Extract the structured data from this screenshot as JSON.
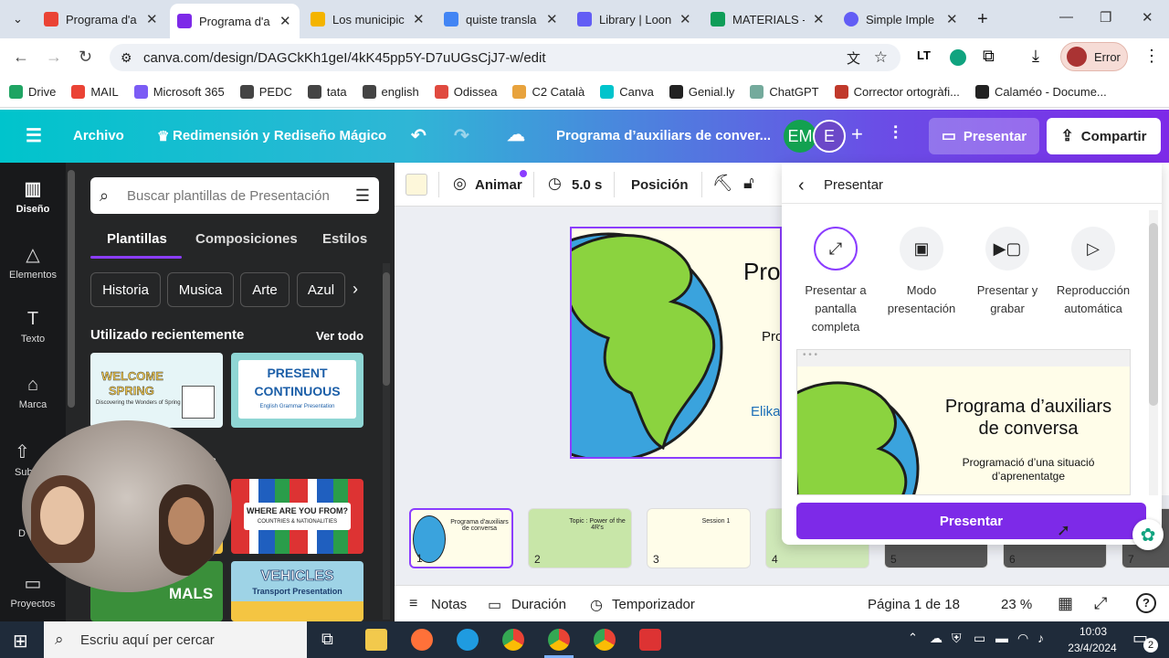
{
  "browser": {
    "tabs": [
      {
        "label": "Programa d'a",
        "color": "#ea4335",
        "active": false
      },
      {
        "label": "Programa d'a",
        "color": "#7d2ae8",
        "active": true
      },
      {
        "label": "Los municipic",
        "color": "#f4b400",
        "active": false
      },
      {
        "label": "quiste transla",
        "color": "#4285f4",
        "active": false
      },
      {
        "label": "Library | Loon",
        "color": "#625df5",
        "active": false
      },
      {
        "label": "MATERIALS -",
        "color": "#0f9d58",
        "active": false
      },
      {
        "label": "Simple Imple",
        "color": "#625df5",
        "active": false
      }
    ],
    "url": "canva.com/design/DAGCkKh1geI/4kK45pp5Y-D7uUGsCjJ7-w/edit",
    "error_label": "Error",
    "bookmarks": [
      {
        "label": "Drive",
        "color": "#1fa463"
      },
      {
        "label": "MAIL",
        "color": "#ea4335"
      },
      {
        "label": "Microsoft 365",
        "color": "#7b5cf5"
      },
      {
        "label": "PEDC",
        "color": "#444444"
      },
      {
        "label": "tata",
        "color": "#444444"
      },
      {
        "label": "english",
        "color": "#444444"
      },
      {
        "label": "Odissea",
        "color": "#e04a3f"
      },
      {
        "label": "C2 Català",
        "color": "#e8a33d"
      },
      {
        "label": "Canva",
        "color": "#00c4cc"
      },
      {
        "label": "Genial.ly",
        "color": "#222222"
      },
      {
        "label": "ChatGPT",
        "color": "#74aa9c"
      },
      {
        "label": "Corrector ortogràfi...",
        "color": "#c0392b"
      },
      {
        "label": "Calaméo - Docume...",
        "color": "#222222"
      }
    ]
  },
  "canva": {
    "menu": {
      "archivo": "Archivo",
      "magic": "Redimensión y Rediseño Mágico",
      "doc_title": "Programa d’auxiliars de conver..."
    },
    "avatars": [
      {
        "initials": "EM",
        "color": "#12a150"
      },
      {
        "initials": "E",
        "color": "#6b48c8"
      }
    ],
    "presentar_label": "Presentar",
    "compartir_label": "Compartir",
    "rail": [
      {
        "label": "Diseño",
        "icon": "layout-icon"
      },
      {
        "label": "Elementos",
        "icon": "shapes-icon"
      },
      {
        "label": "Texto",
        "icon": "text-icon"
      },
      {
        "label": "Marca",
        "icon": "brand-icon"
      },
      {
        "label": "Sub",
        "icon": "upload-icon"
      },
      {
        "label": "D",
        "icon": "draw-icon"
      },
      {
        "label": "Proyectos",
        "icon": "folder-icon"
      }
    ],
    "panel": {
      "search_placeholder": "Buscar plantillas de Presentación",
      "tabs": [
        "Plantillas",
        "Composiciones",
        "Estilos"
      ],
      "chips": [
        "Historia",
        "Musica",
        "Arte",
        "Azul"
      ],
      "recent_title": "Utilizado recientemente",
      "ver_todo": "Ver todo",
      "section2_fragment": "ados",
      "thumbs": {
        "t1_line1": "WELCOME",
        "t1_line2": "SPRING",
        "t1_sub": "Discovering the Wonders of Spring",
        "t2_line1": "PRESENT",
        "t2_line2": "CONTINUOUS",
        "t2_sub": "English Grammar Presentation",
        "t3_title": "WHERE ARE YOU FROM?",
        "t3_sub": "COUNTRIES & NATIONALITIES",
        "t4_title": "VEHICLES",
        "t4_sub": "Transport Presentation",
        "t5_title": "MALS"
      }
    },
    "toolbar": {
      "animar": "Animar",
      "duration": "5.0 s",
      "posicion": "Posición"
    },
    "slide": {
      "title_fragment": "Prog",
      "sub_fragment": "Pro",
      "author_fragment": "Elika"
    },
    "present_panel": {
      "back_title": "Presentar",
      "options": [
        {
          "label": "Presentar a pantalla completa",
          "icon": "expand-icon"
        },
        {
          "label": "Modo presentación",
          "icon": "presenter-icon"
        },
        {
          "label": "Presentar y grabar",
          "icon": "camera-icon"
        },
        {
          "label": "Reproducción automática",
          "icon": "play-icon"
        }
      ],
      "preview_title": "Programa d’auxiliars de conversa",
      "preview_sub": "Programació d’una situació d’aprenentatge",
      "button": "Presentar"
    },
    "filmstrip": [
      {
        "num": "1",
        "title": "Programa d'auxiliars de conversa"
      },
      {
        "num": "2",
        "title": "Topic : Power of the 4R's"
      },
      {
        "num": "3",
        "title": "Session 1"
      },
      {
        "num": "4",
        "title": ""
      },
      {
        "num": "5",
        "title": ""
      },
      {
        "num": "6",
        "title": ""
      },
      {
        "num": "7",
        "title": ""
      }
    ],
    "bottombar": {
      "notas": "Notas",
      "duracion": "Duración",
      "temporizador": "Temporizador",
      "pagina": "Página 1 de 18",
      "zoom": "23 %"
    }
  },
  "taskbar": {
    "search_placeholder": "Escriu aquí per cercar",
    "time": "10:03",
    "date": "23/4/2024",
    "notif_count": "2"
  }
}
